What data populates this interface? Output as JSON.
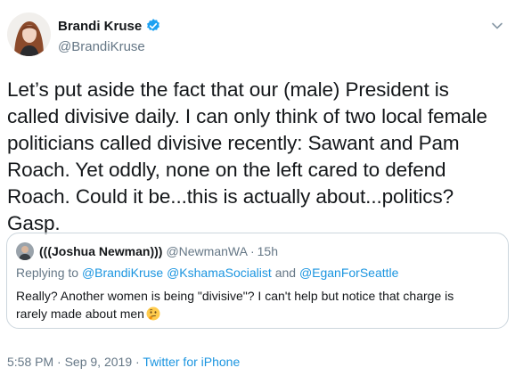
{
  "author": {
    "name": "Brandi Kruse",
    "handle": "@BrandiKruse",
    "verified": true
  },
  "tweet": {
    "lines": [
      "Let’s put aside the fact that our (male) President is",
      "called divisive daily. I can only think of two local female",
      "politicians called divisive recently: Sawant and Pam",
      "Roach. Yet oddly, none on the left cared to defend",
      "Roach. Could it be...this is actually about...politics? Gasp."
    ]
  },
  "quoted": {
    "name": "(((Joshua Newman)))",
    "handle": "@NewmanWA",
    "dot": "·",
    "time": "15h",
    "replying_prefix": "Replying to",
    "mentions": [
      "@BrandiKruse",
      "@KshamaSocialist",
      "and",
      "@EganForSeattle"
    ],
    "text_line1": "Really? Another women is being \"divisive\"? I can't help but notice that charge is",
    "text_line2": "rarely made about men",
    "emoji": "thinking-face"
  },
  "meta": {
    "time": "5:58 PM",
    "sep1": "·",
    "date": "Sep 9, 2019",
    "sep2": "·",
    "source": "Twitter for iPhone"
  },
  "colors": {
    "text": "#14171a",
    "secondary": "#657786",
    "link": "#1b95e0",
    "verified": "#1da1f2",
    "border": "#ccd6dd"
  },
  "icons": [
    "verified-badge-icon",
    "chevron-down-icon",
    "thinking-face-emoji"
  ]
}
